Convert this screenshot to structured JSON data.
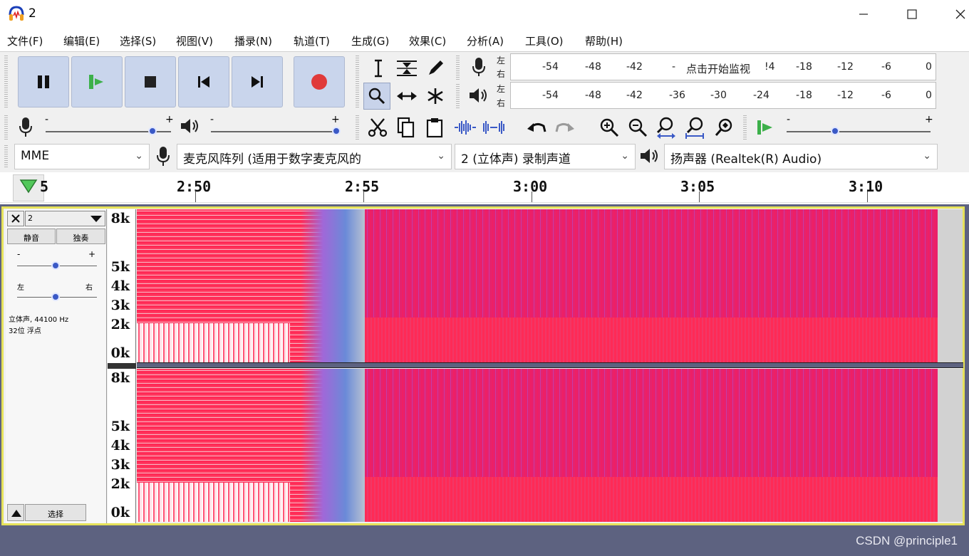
{
  "window": {
    "title": "2"
  },
  "menu": [
    "文件(F)",
    "编辑(E)",
    "选择(S)",
    "视图(V)",
    "播录(N)",
    "轨道(T)",
    "生成(G)",
    "效果(C)",
    "分析(A)",
    "工具(O)",
    "帮助(H)"
  ],
  "meters": {
    "record": {
      "lr": [
        "左",
        "右"
      ],
      "ticks": [
        "-54",
        "-48",
        "-42",
        "-",
        "!4",
        "-18",
        "-12",
        "-6",
        "0"
      ],
      "prompt": "点击开始监视"
    },
    "playback": {
      "lr": [
        "左",
        "右"
      ],
      "ticks": [
        "-54",
        "-48",
        "-42",
        "-36",
        "-30",
        "-24",
        "-18",
        "-12",
        "-6",
        "0"
      ]
    }
  },
  "mixer": {
    "rec_minus": "-",
    "rec_plus": "+",
    "play_minus": "-",
    "play_plus": "+",
    "speed_minus": "-",
    "speed_plus": "+"
  },
  "devices": {
    "host": "MME",
    "input": "麦克风阵列 (适用于数字麦克风的",
    "channels": "2 (立体声) 录制声道",
    "output": "扬声器 (Realtek(R) Audio)"
  },
  "timeline": {
    "labels": [
      "5",
      "2:50",
      "2:55",
      "3:00",
      "3:05",
      "3:10"
    ]
  },
  "track": {
    "name": "2",
    "mute": "静音",
    "solo": "独奏",
    "gain_minus": "-",
    "gain_plus": "+",
    "pan_left": "左",
    "pan_right": "右",
    "info_line1": "立体声, 44100 Hz",
    "info_line2": "32位 浮点",
    "select": "选择",
    "freq_labels": [
      "8k",
      "5k",
      "4k",
      "3k",
      "2k",
      "0k"
    ]
  },
  "watermark": "CSDN @principle1",
  "colors": {
    "spectrum_hot": "#ff2a5c",
    "spectrum_mid": "#e8206c",
    "spectrum_cool": "#6a8ad8",
    "track_bg": "#5d6280",
    "selection_border": "#e6e25a",
    "button_blue": "#c9d5ec",
    "record_red": "#e03a3a",
    "play_green": "#3cb04a"
  }
}
